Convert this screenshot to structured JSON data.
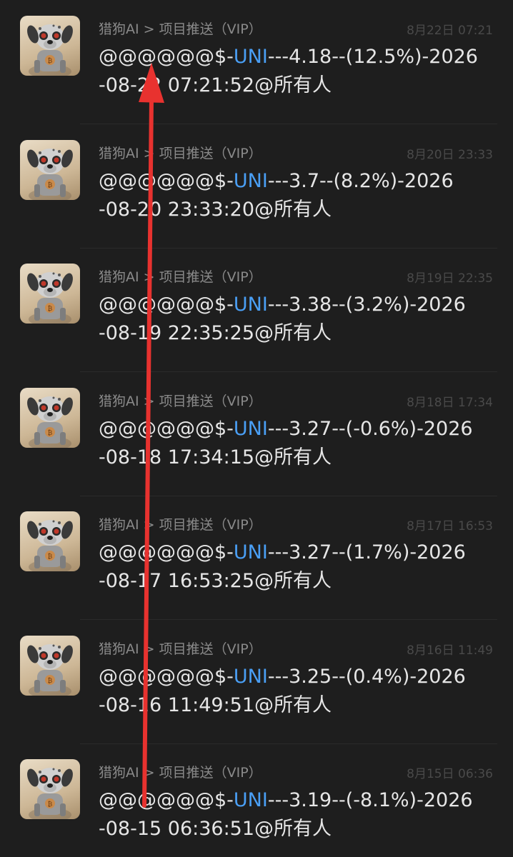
{
  "messages": [
    {
      "sender": "猎狗AI > 项目推送（VIP）",
      "time": "8月22日 07:21",
      "pre": "@@@@@@$-",
      "token": "UNI",
      "post": "---4.18--(12.5%)-2026",
      "line2": "-08-22 07:21:52@所有人",
      "avatar": "robot-dog-avatar"
    },
    {
      "sender": "猎狗AI > 项目推送（VIP）",
      "time": "8月20日 23:33",
      "pre": "@@@@@@$-",
      "token": "UNI",
      "post": "---3.7--(8.2%)-2026",
      "line2": "-08-20 23:33:20@所有人",
      "avatar": "robot-dog-avatar"
    },
    {
      "sender": "猎狗AI > 项目推送（VIP）",
      "time": "8月19日 22:35",
      "pre": "@@@@@@$-",
      "token": "UNI",
      "post": "---3.38--(3.2%)-2026",
      "line2": "-08-19 22:35:25@所有人",
      "avatar": "robot-dog-avatar"
    },
    {
      "sender": "猎狗AI > 项目推送（VIP）",
      "time": "8月18日 17:34",
      "pre": "@@@@@@$-",
      "token": "UNI",
      "post": "---3.27--(-0.6%)-2026",
      "line2": "-08-18 17:34:15@所有人",
      "avatar": "robot-dog-avatar"
    },
    {
      "sender": "猎狗AI > 项目推送（VIP）",
      "time": "8月17日 16:53",
      "pre": "@@@@@@$-",
      "token": "UNI",
      "post": "---3.27--(1.7%)-2026",
      "line2": "-08-17 16:53:25@所有人",
      "avatar": "robot-dog-avatar"
    },
    {
      "sender": "猎狗AI > 项目推送（VIP）",
      "time": "8月16日 11:49",
      "pre": "@@@@@@$-",
      "token": "UNI",
      "post": "---3.25--(0.4%)-2026",
      "line2": "-08-16 11:49:51@所有人",
      "avatar": "robot-dog-avatar"
    },
    {
      "sender": "猎狗AI > 项目推送（VIP）",
      "time": "8月15日 06:36",
      "pre": "@@@@@@$-",
      "token": "UNI",
      "post": "---3.19--(-8.1%)-2026",
      "line2": "-08-15 06:36:51@所有人",
      "avatar": "robot-dog-avatar"
    }
  ],
  "colors": {
    "background": "#1e1e1e",
    "text": "#e6e6e6",
    "sender": "#8a8a8a",
    "time": "#4a4a4a",
    "link": "#4a9ff5",
    "arrow": "#e8322f"
  },
  "overlay": {
    "icon": "red-arrow-up-icon"
  }
}
